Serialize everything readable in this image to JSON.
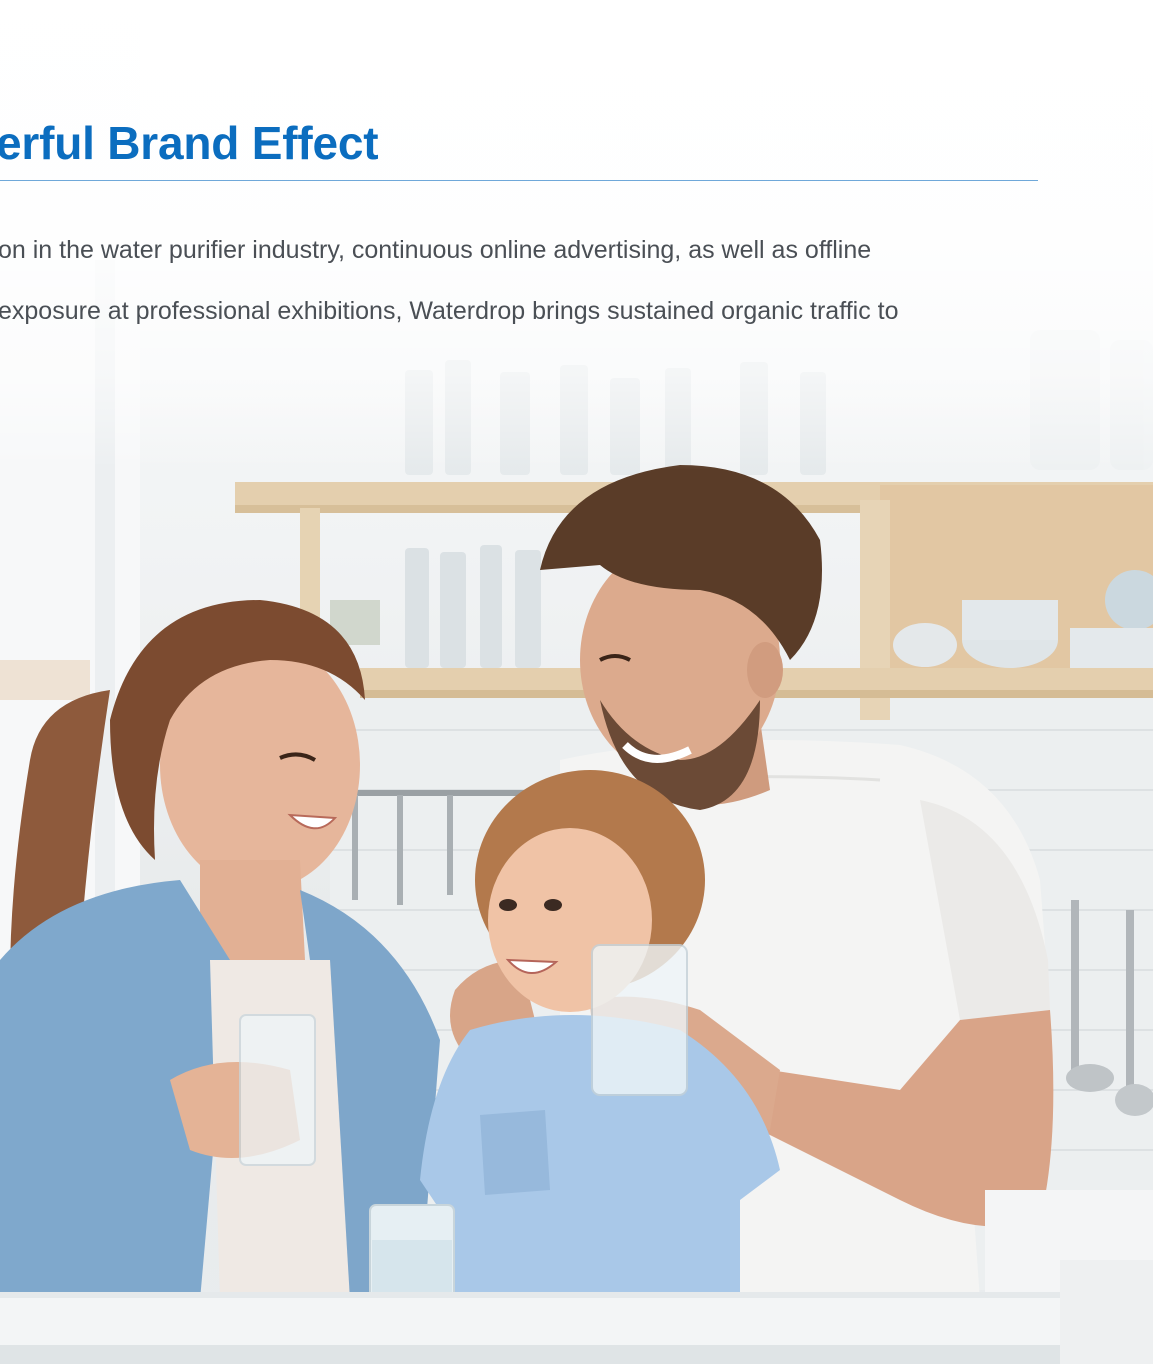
{
  "section": {
    "headline": "erful Brand Effect",
    "body_lines": [
      "on in the water purifier industry, continuous online advertising, as well as offline",
      "exposure at professional exhibitions, Waterdrop brings sustained organic traffic to"
    ]
  },
  "colors": {
    "headline": "#0b6dbf",
    "rule": "#6fa8d9",
    "body_text": "#4a4f55"
  },
  "image": {
    "subject": "family-drinking-water-photo"
  }
}
